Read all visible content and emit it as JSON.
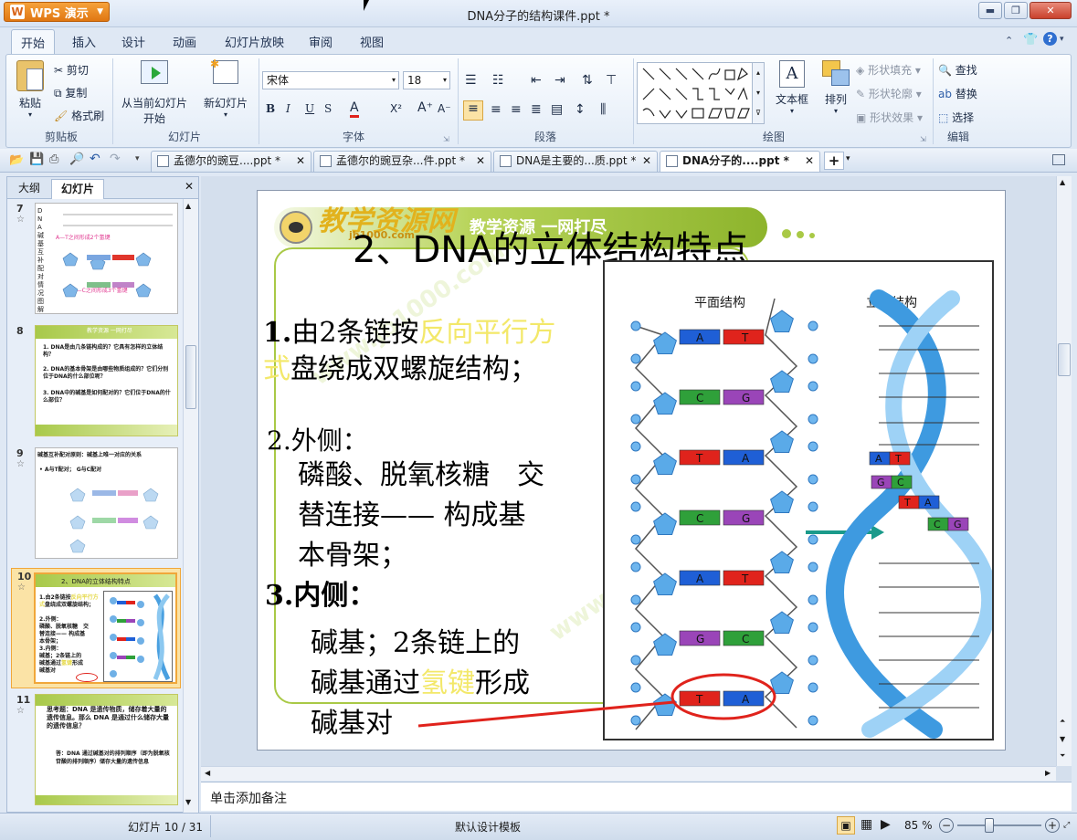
{
  "app": {
    "name": "WPS 演示",
    "window_title": "DNA分子的结构课件.ppt *"
  },
  "ribbon_tabs": [
    "开始",
    "插入",
    "设计",
    "动画",
    "幻灯片放映",
    "审阅",
    "视图"
  ],
  "ribbon": {
    "clipboard": {
      "paste": "粘贴",
      "cut": "剪切",
      "copy": "复制",
      "format_painter": "格式刷",
      "label": "剪贴板"
    },
    "slides": {
      "from_current": "从当前幻灯片",
      "start": "开始",
      "new_slide": "新幻灯片",
      "label": "幻灯片"
    },
    "font": {
      "name": "宋体",
      "size": "18",
      "label": "字体"
    },
    "paragraph": {
      "label": "段落"
    },
    "drawing": {
      "textbox": "文本框",
      "arrange": "排列",
      "shape_fill": "形状填充",
      "shape_outline": "形状轮廓",
      "shape_effect": "形状效果",
      "label": "绘图"
    },
    "edit": {
      "find": "查找",
      "replace": "替换",
      "select": "选择",
      "label": "编辑"
    }
  },
  "doc_tabs": [
    {
      "label": "孟德尔的豌豆....ppt *"
    },
    {
      "label": "孟德尔的豌豆杂...件.ppt *"
    },
    {
      "label": "DNA是主要的...质.ppt *"
    },
    {
      "label": "DNA分子的....ppt *"
    }
  ],
  "panel_tabs": {
    "outline": "大纲",
    "slides": "幻灯片"
  },
  "thumbs": [
    {
      "num": "7",
      "text": "DNA碱基互补配对情况图解",
      "a": "A—T之间形成2个氢键",
      "b": "G—C之间形成3个氢键"
    },
    {
      "num": "8",
      "title": "教学资源 一网打尽",
      "q1": "1. DNA是由几条链构成的？它具有怎样的立体结构？",
      "q2": "2. DNA的基本骨架是由哪些物质组成的？它们分别位于DNA的什么部位呢？",
      "q3": "3. DNA中的碱基是如何配对的？它们位于DNA的什么部位？"
    },
    {
      "num": "9",
      "text": "碱基互补配对原则：碱基上唯一对应的关系",
      "sub": "• A与T配对；  G与C配对"
    },
    {
      "num": "10",
      "text": "2、DNA的立体结构特点"
    },
    {
      "num": "11",
      "text": "思考题：DNA 是遗传物质，储存着大量的遗传信息。那么 DNA 是通过什么储存大量的遗传信息？",
      "ans": "答：DNA 通过碱基对的排列顺序（即为脱氧核苷酸的排列顺序）储存大量的遗传信息"
    }
  ],
  "slide": {
    "banner_logo": "教学资源网",
    "banner_url": "jb1000.com",
    "banner_text": "教学资源 一网打尽",
    "title": "2、DNA的立体结构特点",
    "p1_num": "1.",
    "p1_a": "由2条链按",
    "p1_hl": "反向平行方",
    "p1_hl2": "式",
    "p1_b": "盘绕成双螺旋结构；",
    "p2_head": "2.外侧：",
    "p2_l1": "磷酸、脱氧核糖　交",
    "p2_l2": "替连接——  构成基",
    "p2_l3": "本骨架；",
    "p3_head": "3.内侧：",
    "p3_l1": "碱基；2条链上的",
    "p3_l2a": "碱基通过",
    "p3_l2hl": "氢键",
    "p3_l2b": "形成",
    "p3_l3": "碱基对",
    "fig_left_title": "平面结构",
    "fig_right_title": "立体结构",
    "pairs": [
      {
        "l": "A",
        "r": "T",
        "lc": "#1f5fd6",
        "rc": "#e0231c"
      },
      {
        "l": "C",
        "r": "G",
        "lc": "#2fa03a",
        "rc": "#9a45b8"
      },
      {
        "l": "T",
        "r": "A",
        "lc": "#e0231c",
        "rc": "#1f5fd6"
      },
      {
        "l": "C",
        "r": "G",
        "lc": "#2fa03a",
        "rc": "#9a45b8"
      },
      {
        "l": "A",
        "r": "T",
        "lc": "#1f5fd6",
        "rc": "#e0231c"
      },
      {
        "l": "G",
        "r": "C",
        "lc": "#9a45b8",
        "rc": "#2fa03a"
      },
      {
        "l": "T",
        "r": "A",
        "lc": "#e0231c",
        "rc": "#1f5fd6"
      }
    ],
    "helix_pairs": [
      {
        "l": "A",
        "r": "T"
      },
      {
        "l": "G",
        "r": "C"
      },
      {
        "l": "T",
        "r": "A"
      },
      {
        "l": "C",
        "r": "G"
      }
    ]
  },
  "notes_placeholder": "单击添加备注",
  "status": {
    "slide_pos": "幻灯片 10 / 31",
    "template": "默认设计模板",
    "zoom": "85 %"
  }
}
